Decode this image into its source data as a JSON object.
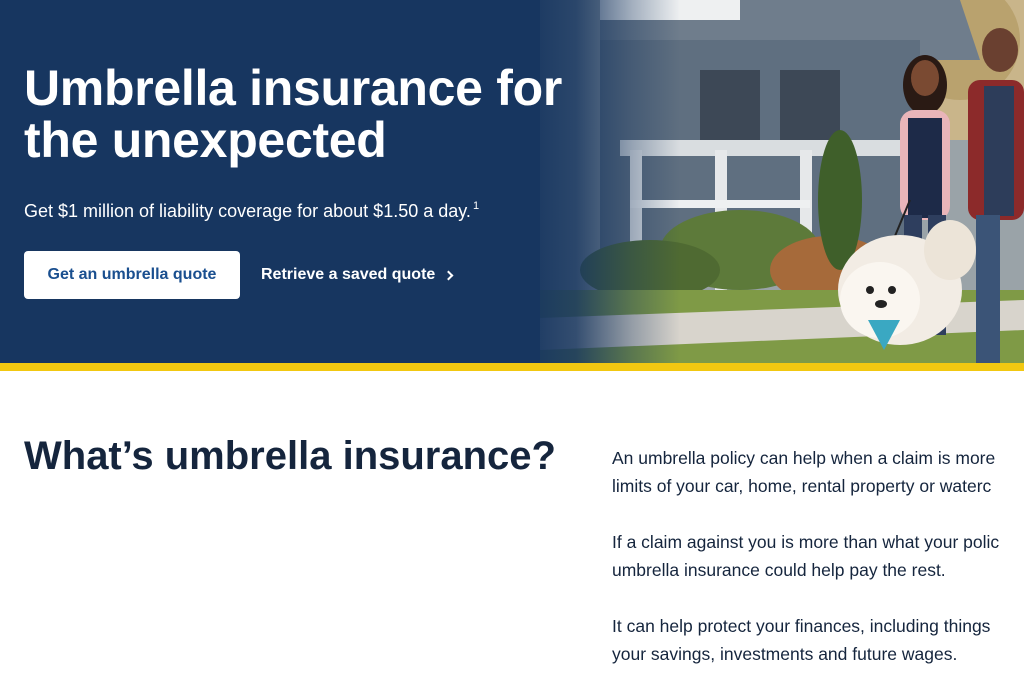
{
  "hero": {
    "title_line1": "Umbrella insurance for",
    "title_line2": "the unexpected",
    "subtitle": "Get $1 million of liability coverage for about $1.50 a day.",
    "footnote_marker": "1",
    "primary_button": "Get an umbrella quote",
    "secondary_link": "Retrieve a saved quote"
  },
  "section": {
    "title": "What’s umbrella insurance?",
    "para1_line1": "An umbrella policy can help when a claim is more",
    "para1_line2": "limits of your car, home, rental property or waterc",
    "para2_line1": "If a claim against you is more than what your polic",
    "para2_line2": "umbrella insurance could help pay the rest.",
    "para3_line1": "It can help protect your finances, including things",
    "para3_line2": "your savings, investments and future wages."
  },
  "colors": {
    "hero_bg": "#173660",
    "accent_bar": "#f2c811",
    "button_text": "#1a4f8f",
    "heading": "#15253d"
  }
}
